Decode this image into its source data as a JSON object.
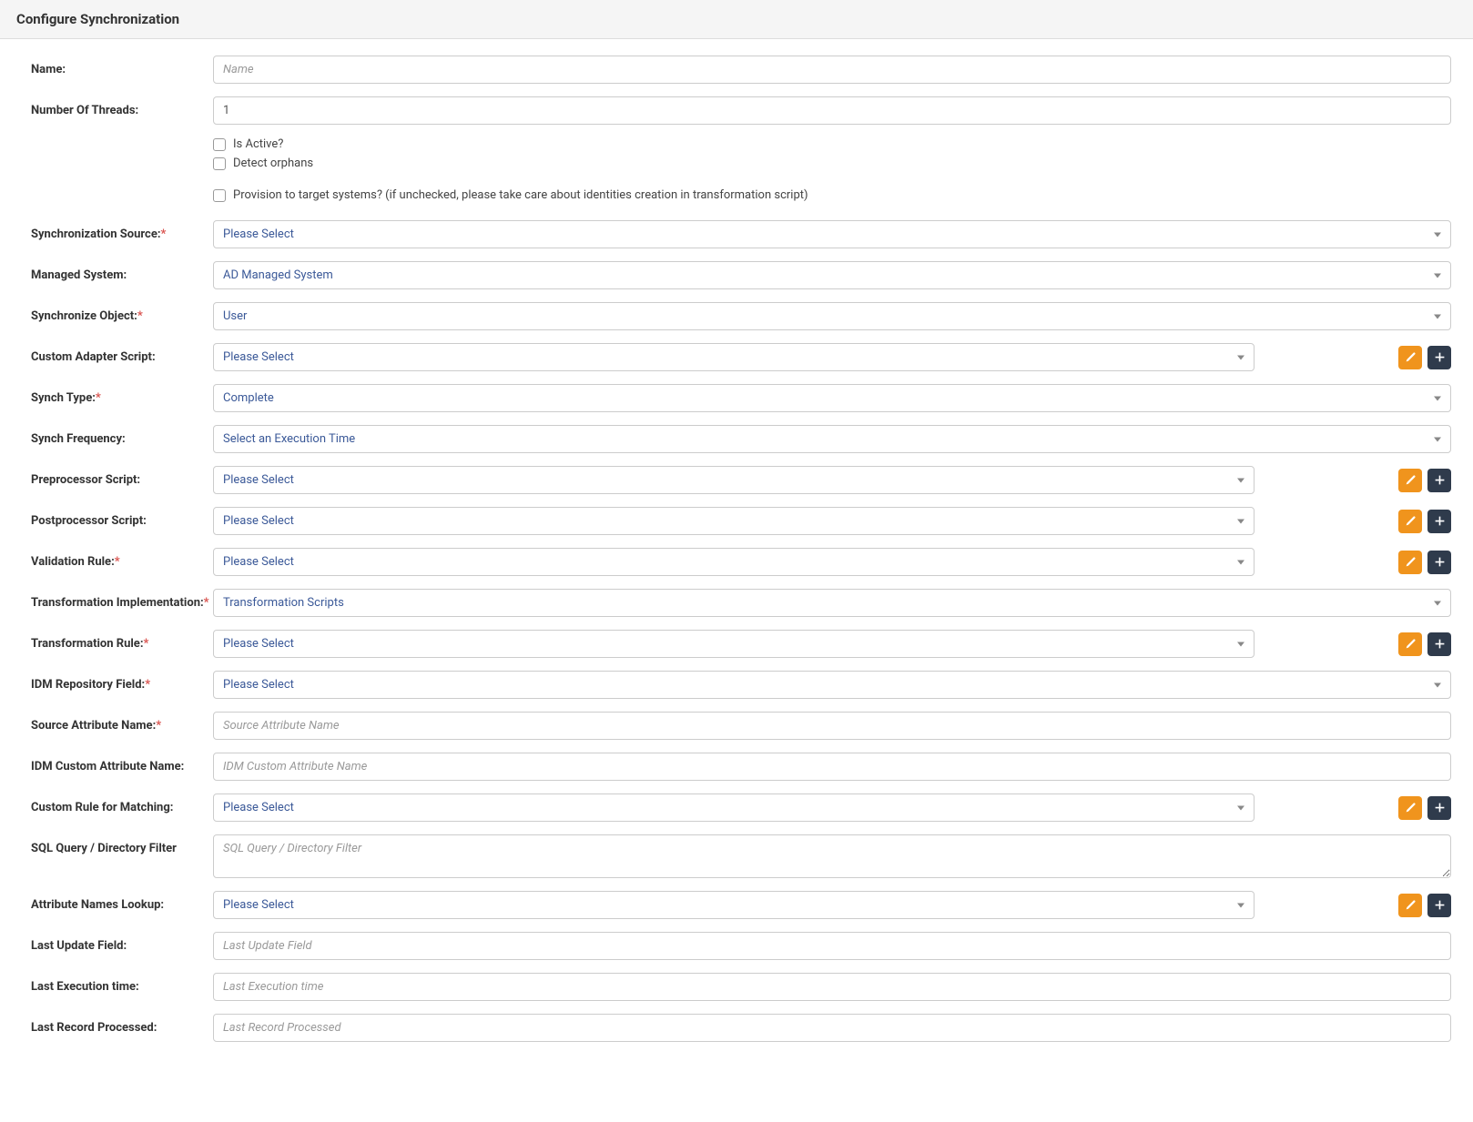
{
  "header": {
    "title": "Configure Synchronization"
  },
  "labels": {
    "name": "Name:",
    "numThreads": "Number Of Threads:",
    "syncSource": "Synchronization Source:",
    "managedSystem": "Managed System:",
    "syncObject": "Synchronize Object:",
    "customAdapter": "Custom Adapter Script:",
    "synchType": "Synch Type:",
    "synchFreq": "Synch Frequency:",
    "preprocessor": "Preprocessor Script:",
    "postprocessor": "Postprocessor Script:",
    "validationRule": "Validation Rule:",
    "transformImpl": "Transformation Implementation:",
    "transformRule": "Transformation Rule:",
    "idmRepoField": "IDM Repository Field:",
    "sourceAttrName": "Source Attribute Name:",
    "idmCustomAttr": "IDM Custom Attribute Name:",
    "customRuleMatching": "Custom Rule for Matching:",
    "sqlQuery": "SQL Query / Directory Filter",
    "attrNamesLookup": "Attribute Names Lookup:",
    "lastUpdateField": "Last Update Field:",
    "lastExecTime": "Last Execution time:",
    "lastRecordProcessed": "Last Record Processed:"
  },
  "placeholders": {
    "name": "Name",
    "sourceAttrName": "Source Attribute Name",
    "idmCustomAttr": "IDM Custom Attribute Name",
    "sqlQuery": "SQL Query / Directory Filter",
    "lastUpdateField": "Last Update Field",
    "lastExecTime": "Last Execution time",
    "lastRecordProcessed": "Last Record Processed"
  },
  "values": {
    "numThreads": "1",
    "pleaseSelect": "Please Select",
    "managedSystem": "AD Managed System",
    "syncObject": "User",
    "synchType": "Complete",
    "synchFreq": "Select an Execution Time",
    "transformImpl": "Transformation Scripts"
  },
  "checkboxes": {
    "isActive": "Is Active?",
    "detectOrphans": "Detect orphans",
    "provision": "Provision to target systems? (if unchecked, please take care about identities creation in transformation script)"
  }
}
